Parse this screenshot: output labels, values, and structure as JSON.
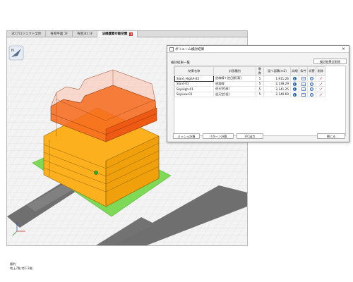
{
  "tabs": [
    {
      "label": "3Dプロジェクト全体",
      "active": false
    },
    {
      "label": "各階平面 1F",
      "active": false
    },
    {
      "label": "各階3D 1F",
      "active": false
    },
    {
      "label": "法規建築可能空間",
      "active": true
    }
  ],
  "tab_close_glyph": "×",
  "status": {
    "line1": "簡約",
    "line2": "地上7階 地下3階"
  },
  "compass": {
    "label": "N"
  },
  "dialog": {
    "title": "ボリューム検討結果",
    "close_glyph": "×",
    "section_label": "検討結果一覧",
    "delete_all_label": "検討結果全削除",
    "columns": [
      "結果名称",
      "計画種別",
      "階数",
      "延べ面積(m2)",
      "詳細",
      "条件",
      "切替",
      "削除"
    ],
    "rows": [
      {
        "name": "Slant_HighA-02",
        "type": "逆斜線＋逆日影[高]",
        "floors": "5",
        "area": "1,911.26"
      },
      {
        "name": "Slant-01",
        "type": "逆斜線",
        "floors": "5",
        "area": "2,138.29"
      },
      {
        "name": "SkyHigh-01",
        "type": "逆天空[高]",
        "floors": "5",
        "area": "2,141.25"
      },
      {
        "name": "SkyLow-01",
        "type": "逆天空[低]",
        "floors": "5",
        "area": "2,149.69"
      }
    ],
    "buttons": {
      "mesh": "メッシュ計算",
      "pattern": "パターン計算",
      "ifc": "IFC出力",
      "close": "閉じる"
    }
  },
  "colors": {
    "building_lower": "#fcb01e",
    "building_upper": "#f56c1f",
    "site": "#7ed957",
    "road": "#6f6f6f",
    "info_icon": "#1d5fb0",
    "tab_close": "#d9302c"
  },
  "icons": {
    "detail": "info-icon",
    "condition": "document-icon",
    "switch": "swap-icon",
    "delete": "eraser-icon",
    "compass": "compass-icon",
    "axis": "axis-gizmo-icon"
  }
}
